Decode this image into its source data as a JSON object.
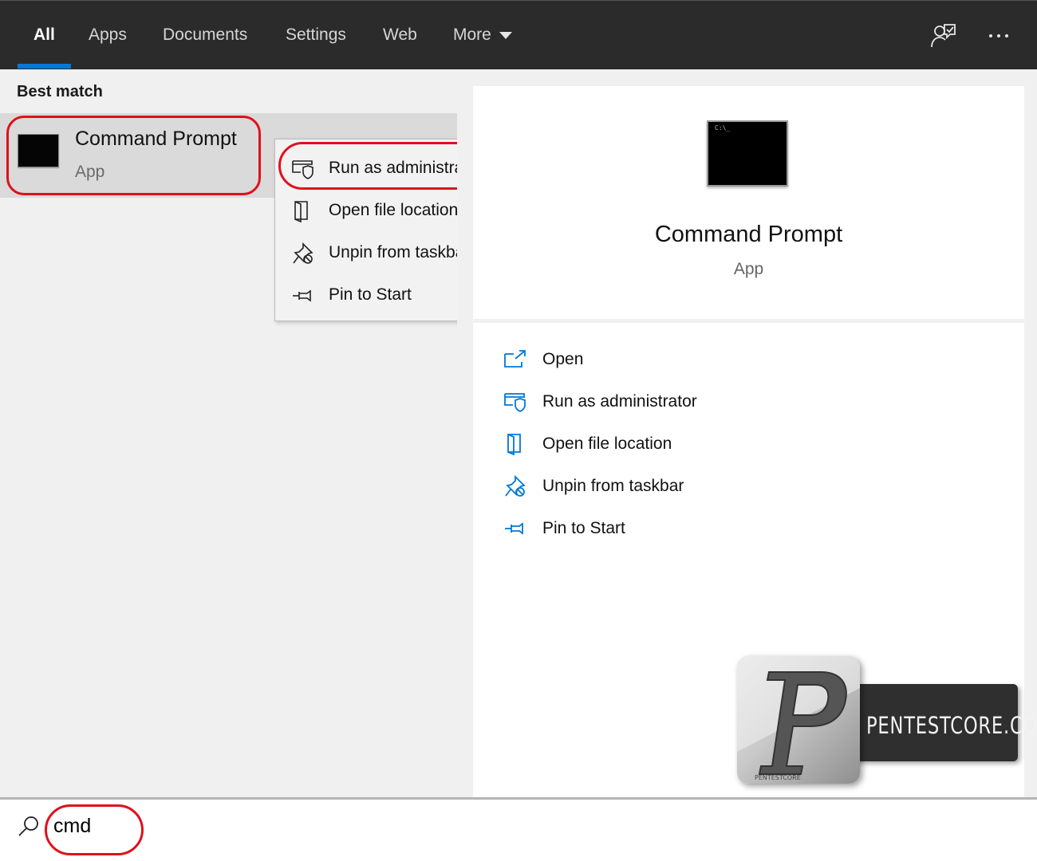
{
  "nav": {
    "tabs": [
      {
        "label": "All",
        "active": true
      },
      {
        "label": "Apps"
      },
      {
        "label": "Documents"
      },
      {
        "label": "Settings"
      },
      {
        "label": "Web"
      },
      {
        "label": "More"
      }
    ],
    "accent": "#0078d7",
    "right_icons": [
      "feedback-icon",
      "more-options-icon"
    ]
  },
  "results": {
    "section_title": "Best match",
    "best_match": {
      "title": "Command Prompt",
      "subtitle": "App",
      "icon": "command-prompt-icon"
    }
  },
  "context_menu": {
    "items": [
      {
        "label": "Run as administrator",
        "icon": "shield-window-icon"
      },
      {
        "label": "Open file location",
        "icon": "folder-open-icon"
      },
      {
        "label": "Unpin from taskbar",
        "icon": "unpin-icon"
      },
      {
        "label": "Pin to Start",
        "icon": "pin-icon"
      }
    ]
  },
  "preview": {
    "title": "Command Prompt",
    "subtitle": "App",
    "thumb_text": "C:\\_",
    "actions": [
      {
        "label": "Open",
        "icon": "open-window-icon"
      },
      {
        "label": "Run as administrator",
        "icon": "shield-window-icon"
      },
      {
        "label": "Open file location",
        "icon": "folder-open-icon"
      },
      {
        "label": "Unpin from taskbar",
        "icon": "unpin-icon"
      },
      {
        "label": "Pin to Start",
        "icon": "pin-icon"
      }
    ]
  },
  "highlight_color": "#e0101c",
  "watermark": {
    "text": "PENTESTCORE.COM",
    "logo_letter": "P",
    "logo_caption": "PENTESTCORE"
  },
  "search": {
    "value": "cmd"
  }
}
